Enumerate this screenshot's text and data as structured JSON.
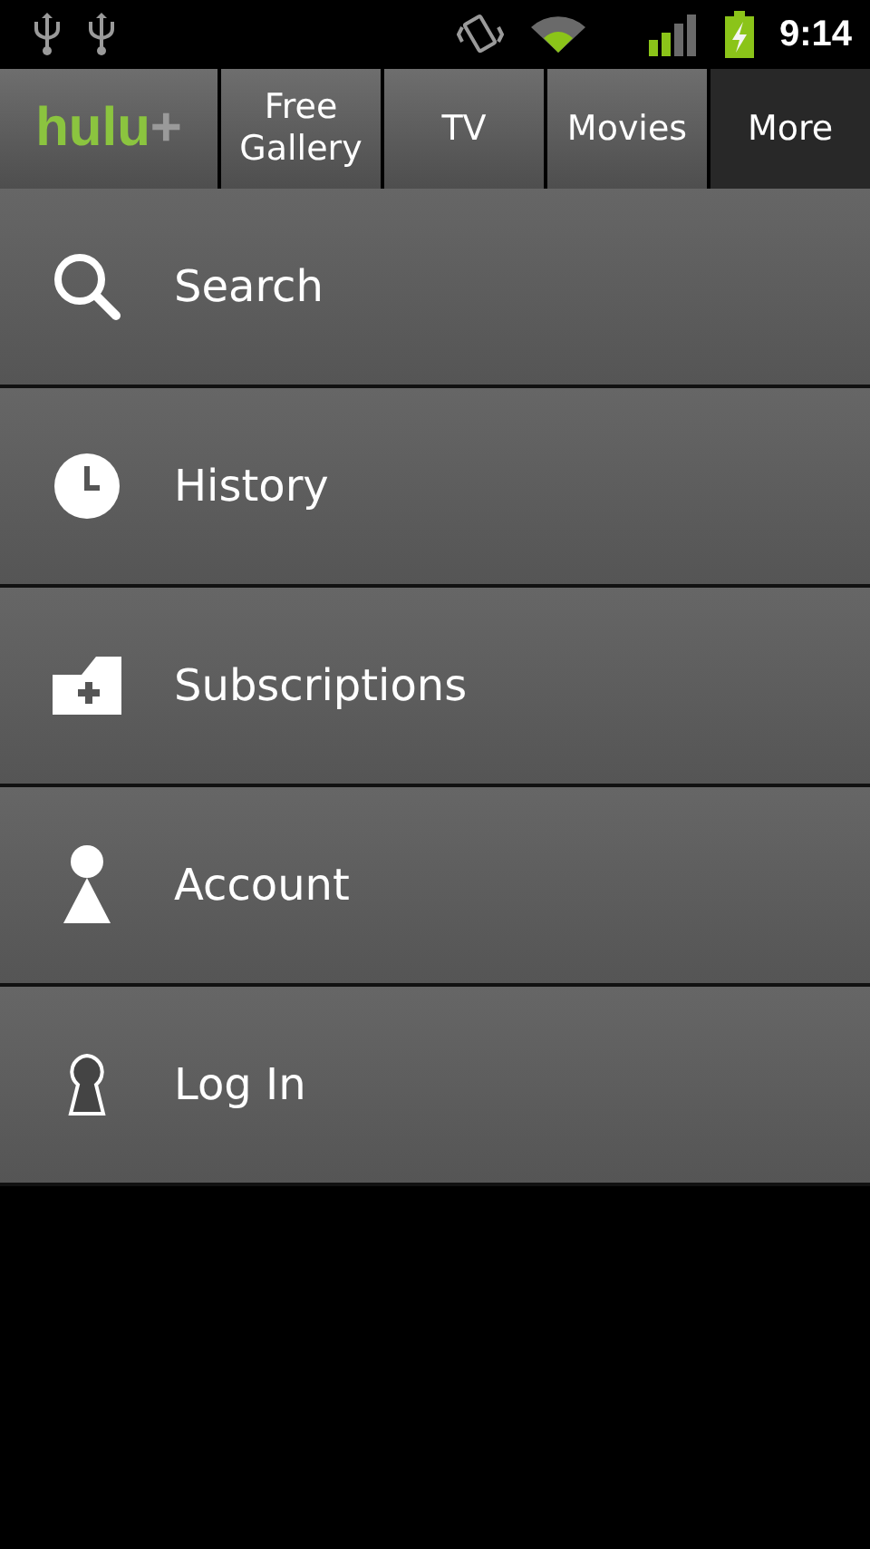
{
  "status_bar": {
    "time": "9:14"
  },
  "header": {
    "logo": {
      "text": "hulu",
      "mark": "+"
    },
    "tabs": [
      {
        "label": "Free Gallery",
        "selected": false
      },
      {
        "label": "TV",
        "selected": false
      },
      {
        "label": "Movies",
        "selected": false
      },
      {
        "label": "More",
        "selected": true
      }
    ]
  },
  "menu": [
    {
      "kind": "search",
      "label": "Search"
    },
    {
      "kind": "history",
      "label": "History"
    },
    {
      "kind": "subscriptions",
      "label": "Subscriptions"
    },
    {
      "kind": "account",
      "label": "Account"
    },
    {
      "kind": "login",
      "label": "Log In"
    }
  ]
}
